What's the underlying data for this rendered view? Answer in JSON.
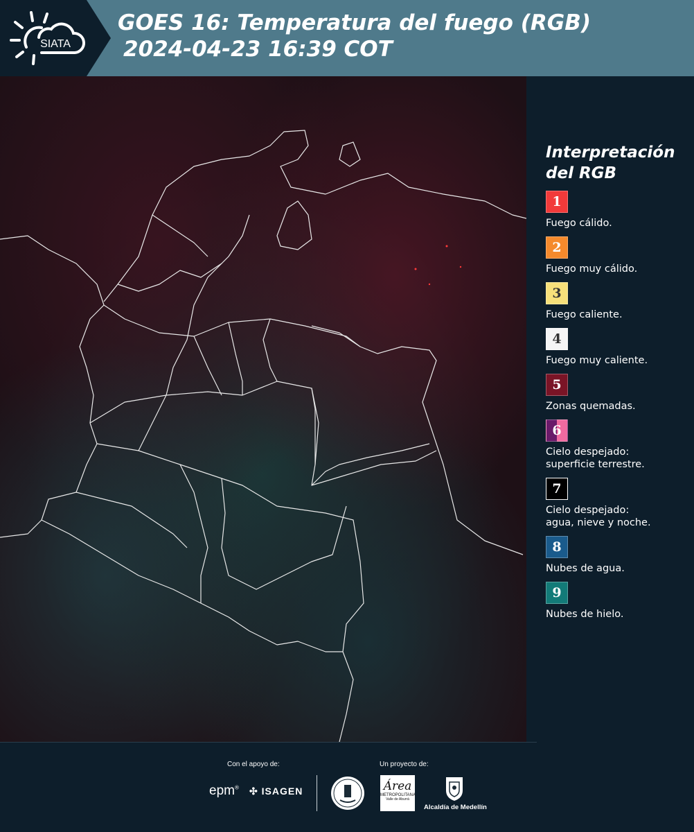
{
  "header": {
    "logo_text": "SIATA",
    "title_line1": "GOES 16: Temperatura del fuego (RGB)",
    "title_line2": "2024-04-23 16:39 COT"
  },
  "legend": {
    "title": "Interpretación del RGB",
    "items": [
      {
        "number": "1",
        "label": "Fuego cálido.",
        "color": "#f23a3a"
      },
      {
        "number": "2",
        "label": "Fuego muy cálido.",
        "color": "#f58a2c"
      },
      {
        "number": "3",
        "label": "Fuego caliente.",
        "color": "#f7e07a"
      },
      {
        "number": "4",
        "label": "Fuego muy caliente.",
        "color": "#f5f5f5"
      },
      {
        "number": "5",
        "label": "Zonas quemadas.",
        "color": "#7a1426"
      },
      {
        "number": "6",
        "label": "Cielo despejado:\nsuperficie terrestre.",
        "color": "#6a1a6a",
        "color2": "#f06aa0"
      },
      {
        "number": "7",
        "label": "Cielo despejado:\nagua, nieve y noche.",
        "color": "#000000"
      },
      {
        "number": "8",
        "label": "Nubes de agua.",
        "color": "#1a5b8c"
      },
      {
        "number": "9",
        "label": "Nubes de hielo.",
        "color": "#137b78"
      }
    ]
  },
  "footer": {
    "support_label": "Con el apoyo de:",
    "project_label": "Un proyecto de:",
    "sponsor1": "epm",
    "sponsor2": "ISAGEN",
    "partner1_line1": "Área",
    "partner1_line2": "METROPOLITANA",
    "partner1_line3": "Valle de Aburrá",
    "partner2": "Alcaldía de Medellín"
  }
}
